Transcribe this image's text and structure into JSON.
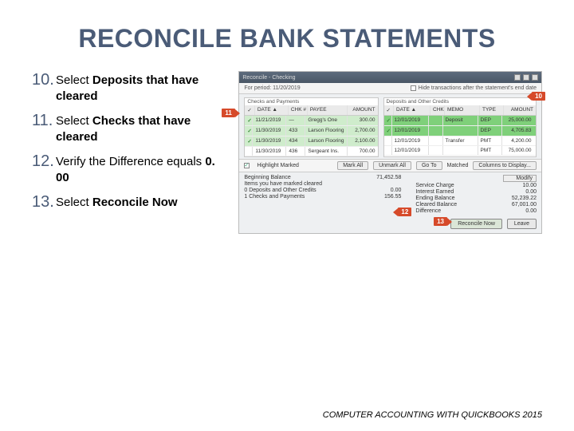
{
  "title": "RECONCILE BANK STATEMENTS",
  "steps": [
    {
      "num": "10.",
      "prefix": "Select ",
      "bold": "Deposits that have cleared",
      "suffix": ""
    },
    {
      "num": "11.",
      "prefix": "Select ",
      "bold": "Checks that have cleared",
      "suffix": ""
    },
    {
      "num": "12.",
      "prefix": "Verify the Difference equals ",
      "bold": "0. 00",
      "suffix": ""
    },
    {
      "num": "13.",
      "prefix": "Select ",
      "bold": "Reconcile Now",
      "suffix": ""
    }
  ],
  "window": {
    "title": "Reconcile - Checking",
    "period_label": "For period: 11/20/2019",
    "hide_label": "Hide transactions after the statement's end date",
    "sections": {
      "checks": "Checks and Payments",
      "deposits": "Deposits and Other Credits"
    },
    "headers": {
      "mark": "✓",
      "date": "DATE ▲",
      "chk": "CHK #",
      "payee": "PAYEE",
      "amount": "AMOUNT",
      "memo": "MEMO",
      "type": "TYPE"
    },
    "checks_rows": [
      {
        "mark": "✓",
        "date": "11/21/2019",
        "chk": "—",
        "payee": "Gregg's One",
        "amt": "300.00"
      },
      {
        "mark": "✓",
        "date": "11/30/2019",
        "chk": "433",
        "payee": "Larson Flooring",
        "amt": "2,700.00"
      },
      {
        "mark": "✓",
        "date": "11/30/2019",
        "chk": "434",
        "payee": "Larson Flooring",
        "amt": "2,100.00"
      },
      {
        "mark": "",
        "date": "11/30/2019",
        "chk": "436",
        "payee": "Sergeant Ins.",
        "amt": "700.00"
      }
    ],
    "deposits_rows": [
      {
        "mark": "✓",
        "date": "12/01/2019",
        "chk": "",
        "memo": "Deposit",
        "type": "DEP",
        "amt": "25,000.00"
      },
      {
        "mark": "✓",
        "date": "12/01/2019",
        "chk": "",
        "memo": "",
        "type": "DEP",
        "amt": "4,705.83"
      },
      {
        "mark": "",
        "date": "12/01/2019",
        "chk": "",
        "memo": "Transfer",
        "type": "PMT",
        "amt": "4,200.00"
      },
      {
        "mark": "",
        "date": "12/01/2019",
        "chk": "",
        "memo": "",
        "type": "PMT",
        "amt": "75,000.00"
      }
    ],
    "midbar": {
      "highlight_label": "Highlight Marked",
      "mark_all": "Mark All",
      "unmark_all": "Unmark All",
      "goto": "Go To",
      "matched": "Matched",
      "columns": "Columns to Display..."
    },
    "summary": {
      "left": [
        {
          "k": "Beginning Balance",
          "v": "71,452.58"
        },
        {
          "k": "Items you have marked cleared",
          "v": ""
        },
        {
          "k": "0  Deposits and Other Credits",
          "v": "0.00"
        },
        {
          "k": "1  Checks and Payments",
          "v": "156.55"
        }
      ],
      "right": [
        {
          "k": "Modify",
          "v": ""
        },
        {
          "k": "Service Charge",
          "v": "10.00"
        },
        {
          "k": "Interest Earned",
          "v": "0.00"
        },
        {
          "k": "Ending Balance",
          "v": "52,239.22"
        },
        {
          "k": "Cleared Balance",
          "v": "67,001.00"
        },
        {
          "k": "Difference",
          "v": "0.00"
        }
      ]
    },
    "actions": {
      "reconcile": "Reconcile Now",
      "leave": "Leave"
    }
  },
  "callouts": {
    "c10": "10",
    "c11": "11",
    "c12": "12",
    "c13": "13"
  },
  "footer": "COMPUTER ACCOUNTING WITH QUICKBOOKS 2015"
}
